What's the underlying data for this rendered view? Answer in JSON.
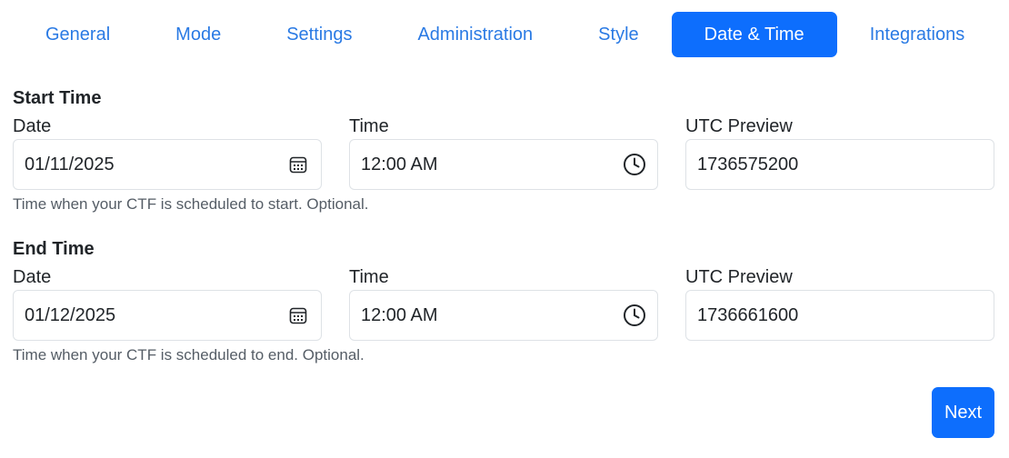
{
  "tabs": [
    {
      "label": "General",
      "active": false
    },
    {
      "label": "Mode",
      "active": false
    },
    {
      "label": "Settings",
      "active": false
    },
    {
      "label": "Administration",
      "active": false
    },
    {
      "label": "Style",
      "active": false
    },
    {
      "label": "Date & Time",
      "active": true
    },
    {
      "label": "Integrations",
      "active": false
    }
  ],
  "start": {
    "title": "Start Time",
    "date_label": "Date",
    "date_value": "01/11/2025",
    "time_label": "Time",
    "time_value": "12:00 AM",
    "utc_label": "UTC Preview",
    "utc_value": "1736575200",
    "help": "Time when your CTF is scheduled to start. Optional."
  },
  "end": {
    "title": "End Time",
    "date_label": "Date",
    "date_value": "01/12/2025",
    "time_label": "Time",
    "time_value": "12:00 AM",
    "utc_label": "UTC Preview",
    "utc_value": "1736661600",
    "help": "Time when your CTF is scheduled to end. Optional."
  },
  "next_label": "Next",
  "colors": {
    "accent": "#0d6efd",
    "tab_link": "#2a7ae4",
    "border": "#dee2e6",
    "help_text": "#555d66"
  },
  "icons": {
    "date": "calendar-icon",
    "time": "clock-icon"
  }
}
